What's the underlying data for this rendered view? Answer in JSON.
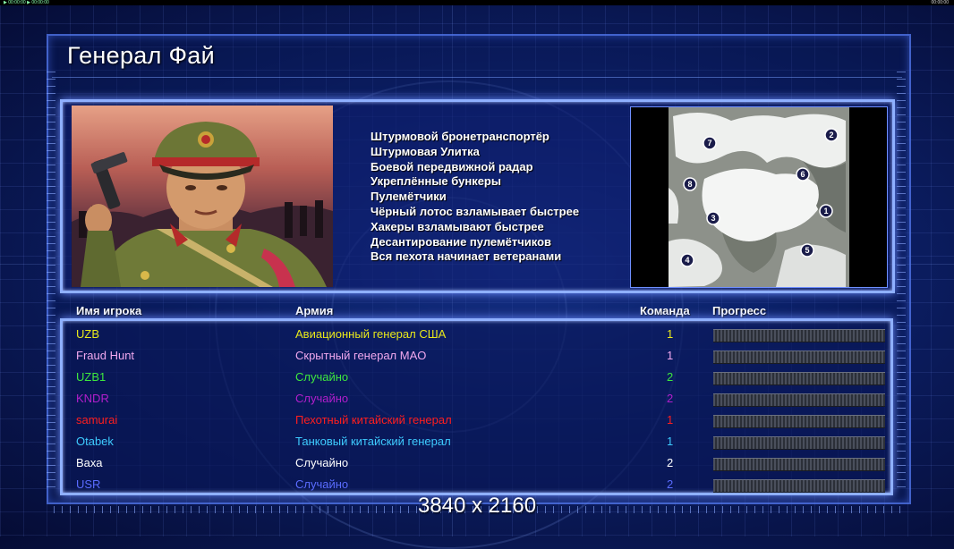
{
  "topbar": {
    "left_text": "▶ 00:00:00 ▶ 00:00:00",
    "right_text": "00:00:00"
  },
  "title": "Генерал Фай",
  "features": [
    "Штурмовой бронетранспортёр",
    "Штурмовая Улитка",
    "Боевой передвижной радар",
    "Укреплённые бункеры",
    "Пулемётчики",
    "Чёрный лотос взламывает быстрее",
    "Хакеры взламывают быстрее",
    "Десантирование пулемётчиков",
    "Вся пехота начинает ветеранами"
  ],
  "minimap": {
    "start_positions": [
      "7",
      "2",
      "6",
      "8",
      "3",
      "1",
      "5",
      "4"
    ]
  },
  "columns": {
    "player_name": "Имя игрока",
    "army": "Армия",
    "team": "Команда",
    "progress": "Прогресс"
  },
  "players": [
    {
      "name": "UZB",
      "army": "Авиационный генерал США",
      "team": "1",
      "color": "#e8e81a",
      "progress": 1
    },
    {
      "name": "Fraud Hunt",
      "army": "Скрытный генерал MAO",
      "team": "1",
      "color": "#f0a8ee",
      "progress": 1
    },
    {
      "name": "UZB1",
      "army": "Случайно",
      "team": "2",
      "color": "#3ee83e",
      "progress": 1
    },
    {
      "name": "KNDR",
      "army": "Случайно",
      "team": "2",
      "color": "#b21ecc",
      "progress": 1
    },
    {
      "name": "samurai",
      "army": "Пехотный китайский генерал",
      "team": "1",
      "color": "#ff1e1e",
      "progress": 1
    },
    {
      "name": "Otabek",
      "army": "Танковый китайский генерал",
      "team": "1",
      "color": "#3ecbff",
      "progress": 1
    },
    {
      "name": "Ваха",
      "army": "Случайно",
      "team": "2",
      "color": "#ffffff",
      "progress": 1
    },
    {
      "name": "USR",
      "army": "Случайно",
      "team": "2",
      "color": "#5a6cff",
      "progress": 1
    }
  ],
  "resolution_label": "3840 x 2160",
  "colors": {
    "panel_border": "#8fb0ff",
    "background": "#0c1f66"
  },
  "icons": {
    "portrait": "general-portrait-image",
    "map": "minimap-image"
  }
}
